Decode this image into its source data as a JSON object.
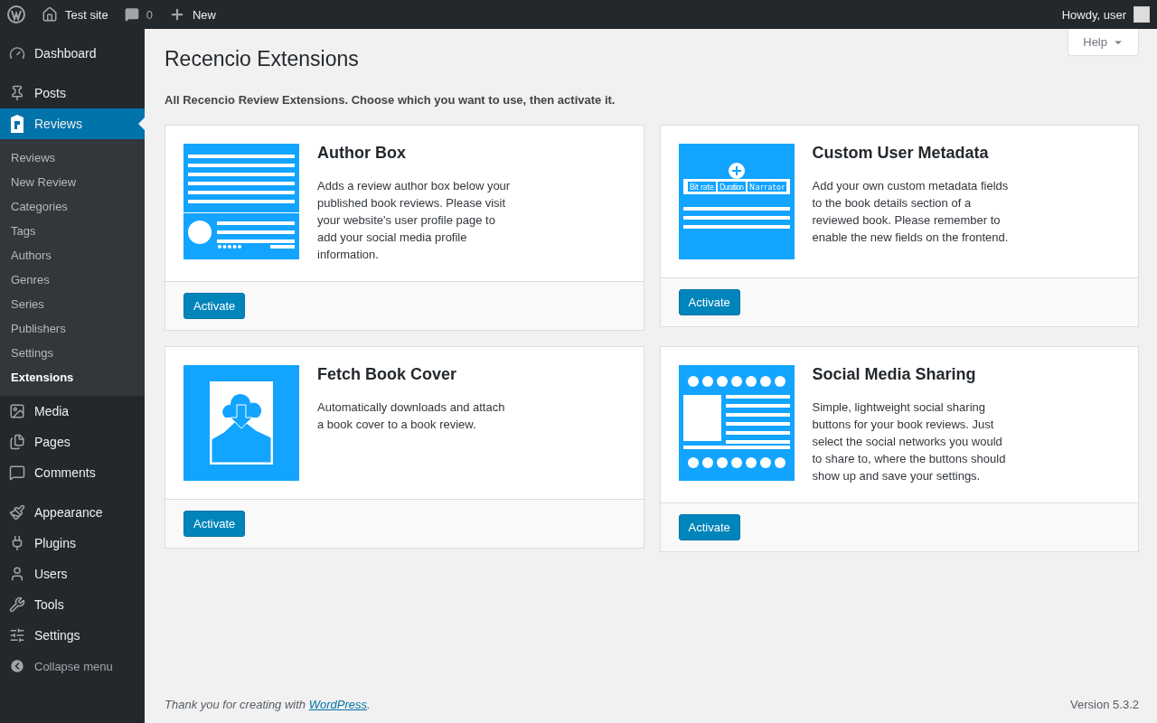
{
  "admin_bar": {
    "site": "Test site",
    "comments": "0",
    "new": "New",
    "greeting": "Howdy, user"
  },
  "sidebar": {
    "items": [
      {
        "label": "Dashboard",
        "selected": false
      },
      {
        "label": "Posts",
        "selected": false
      },
      {
        "label": "Reviews",
        "selected": true,
        "children": [
          {
            "label": "Reviews",
            "selected": false
          },
          {
            "label": "New Review",
            "selected": false
          },
          {
            "label": "Categories",
            "selected": false
          },
          {
            "label": "Tags",
            "selected": false
          },
          {
            "label": "Authors",
            "selected": false
          },
          {
            "label": "Genres",
            "selected": false
          },
          {
            "label": "Series",
            "selected": false
          },
          {
            "label": "Publishers",
            "selected": false
          },
          {
            "label": "Settings",
            "selected": false
          },
          {
            "label": "Extensions",
            "selected": true
          }
        ]
      },
      {
        "label": "Media",
        "selected": false
      },
      {
        "label": "Pages",
        "selected": false
      },
      {
        "label": "Comments",
        "selected": false
      },
      {
        "label": "Appearance",
        "selected": false
      },
      {
        "label": "Plugins",
        "selected": false
      },
      {
        "label": "Users",
        "selected": false
      },
      {
        "label": "Tools",
        "selected": false
      },
      {
        "label": "Settings",
        "selected": false
      }
    ],
    "collapse": "Collapse menu"
  },
  "help": "Help",
  "title": "Recencio Extensions",
  "intro": "All Recencio Review Extensions. Choose which you want to use, then activate it.",
  "extensions": [
    {
      "kind": "author",
      "title": "Author Box",
      "description": "Adds a review author box below your published book reviews. Please visit your website's user profile page to add your social media profile information.",
      "button": "Activate"
    },
    {
      "kind": "metadata",
      "title": "Custom User Metadata",
      "description": "Add your own custom metadata fields to the book details section of a reviewed book. Please remember to enable the new fields on the frontend.",
      "button": "Activate",
      "image_labels": [
        "Bit rate",
        "Duration",
        "Narrator"
      ]
    },
    {
      "kind": "cover",
      "title": "Fetch Book Cover",
      "description": "Automatically downloads and attach a book cover to a book review.",
      "button": "Activate"
    },
    {
      "kind": "social",
      "title": "Social Media Sharing",
      "description": "Simple, lightweight social sharing buttons for your book reviews. Just select the social networks you would to share to, where the buttons should show up and save your settings.",
      "button": "Activate"
    }
  ],
  "footer": {
    "before": "Thank you for creating with",
    "link": "WordPress",
    "after": ".",
    "version": "Version 5.3.2"
  }
}
